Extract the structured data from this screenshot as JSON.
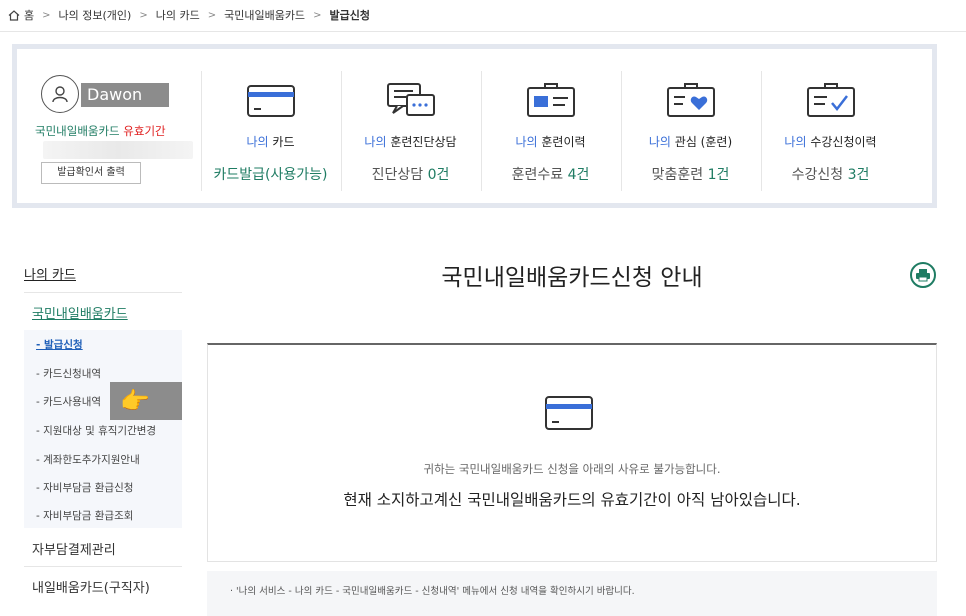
{
  "breadcrumb": {
    "home_icon": "home-icon",
    "items": [
      "홈",
      "나의 정보(개인)",
      "나의 카드",
      "국민내일배움카드",
      "발급신청"
    ]
  },
  "profile": {
    "username": "Dawon",
    "validity_green": "국민내일배움카드",
    "validity_red": "유효기간",
    "print_cert_label": "발급확인서 출력"
  },
  "stats": [
    {
      "icon": "card-icon",
      "label_prefix": "나의",
      "label": "카드",
      "value_prefix": "카드발급(사용가능)",
      "value_suffix": ""
    },
    {
      "icon": "chat-icon",
      "label_prefix": "나의",
      "label": "훈련진단상담",
      "value_prefix": "진단상담 ",
      "value_suffix": "0건"
    },
    {
      "icon": "id-card-icon",
      "label_prefix": "나의",
      "label": "훈련이력",
      "value_prefix": "훈련수료 ",
      "value_suffix": "4건"
    },
    {
      "icon": "heart-case-icon",
      "label_prefix": "나의",
      "label": "관심 (훈련)",
      "value_prefix": "맞춤훈련 ",
      "value_suffix": "1건"
    },
    {
      "icon": "checklist-icon",
      "label_prefix": "나의",
      "label": "수강신청이력",
      "value_prefix": "수강신청 ",
      "value_suffix": "3건"
    }
  ],
  "sidebar": {
    "top": "나의 카드",
    "sub": "국민내일배움카드",
    "items": [
      "- 발급신청",
      "- 카드신청내역",
      "- 카드사용내역",
      "- 지원대상 및 휴직기간변경",
      "- 계좌한도추가지원안내",
      "- 자비부담금 환급신청",
      "- 자비부담금 환급조회"
    ],
    "bottom": [
      "자부담결제관리",
      "내일배움카드(구직자)"
    ]
  },
  "main": {
    "title": "국민내일배움카드신청 안내",
    "print_icon": "printer-icon",
    "card_icon": "card-icon",
    "message_small": "귀하는 국민내일배움카드 신청을 아래의 사유로 불가능합니다.",
    "message_big": "현재 소지하고계신 국민내일배움카드의 유효기간이 아직 남아있습니다.",
    "note": "· '나의 서비스 - 나의 카드 - 국민내일배움카드 - 신청내역' 메뉴에서 신청 내역을 확인하시기 바랍니다."
  },
  "colors": {
    "accent_green": "#1f7c63",
    "accent_blue": "#3a6fd8",
    "alert_red": "#e02020"
  }
}
